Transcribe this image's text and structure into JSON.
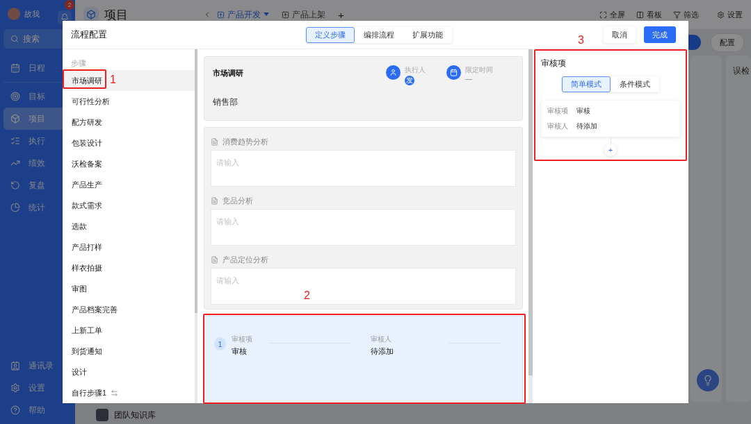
{
  "app": {
    "user": {
      "name": "故我"
    },
    "notifications": {
      "count": "2"
    },
    "search": {
      "placeholder": "搜索"
    },
    "nav": [
      {
        "label": "日程",
        "selected": false
      },
      {
        "label": "目标",
        "selected": false
      },
      {
        "label": "项目",
        "selected": true
      },
      {
        "label": "执行",
        "selected": false
      },
      {
        "label": "绩效",
        "selected": false
      },
      {
        "label": "复盘",
        "selected": false
      },
      {
        "label": "统计",
        "selected": false
      }
    ],
    "nav_bottom": [
      {
        "label": "通讯录"
      },
      {
        "label": "设置"
      },
      {
        "label": "帮助"
      }
    ],
    "page_title": "项目",
    "tabs": [
      {
        "label": "产品开发",
        "selected": true
      },
      {
        "label": "产品上架",
        "selected": false
      }
    ],
    "add_tab": "+",
    "toolbar": [
      {
        "label": "全屏"
      },
      {
        "label": "看板"
      },
      {
        "label": "筛选"
      },
      {
        "label": "设置"
      }
    ],
    "config_button": "配置",
    "column_title": "误检",
    "knowledge_base": "团队知识库"
  },
  "dialog": {
    "title": "流程配置",
    "tabs": [
      {
        "label": "定义步骤",
        "selected": true
      },
      {
        "label": "编排流程",
        "selected": false
      },
      {
        "label": "扩展功能",
        "selected": false
      }
    ],
    "cancel": "取消",
    "done": "完成",
    "steps": {
      "heading": "步骤",
      "items": [
        {
          "label": "市场调研",
          "selected": true,
          "custom": false
        },
        {
          "label": "可行性分析",
          "selected": false,
          "custom": false
        },
        {
          "label": "配方研发",
          "selected": false,
          "custom": false
        },
        {
          "label": "包装设计",
          "selected": false,
          "custom": false
        },
        {
          "label": "沃检备案",
          "selected": false,
          "custom": false
        },
        {
          "label": "产品生产",
          "selected": false,
          "custom": false
        },
        {
          "label": "款式需求",
          "selected": false,
          "custom": false
        },
        {
          "label": "选款",
          "selected": false,
          "custom": false
        },
        {
          "label": "产品打样",
          "selected": false,
          "custom": false
        },
        {
          "label": "样衣拍摄",
          "selected": false,
          "custom": false
        },
        {
          "label": "审图",
          "selected": false,
          "custom": false
        },
        {
          "label": "产品档案完善",
          "selected": false,
          "custom": false
        },
        {
          "label": "上新工单",
          "selected": false,
          "custom": false
        },
        {
          "label": "到货通知",
          "selected": false,
          "custom": false
        },
        {
          "label": "设计",
          "selected": false,
          "custom": false
        },
        {
          "label": "自行步骤1",
          "selected": false,
          "custom": true
        }
      ]
    },
    "step_card": {
      "title": "市场调研",
      "assignee_label": "执行人",
      "assignee": "发",
      "deadline_label": "限定时间",
      "deadline": "—",
      "department": "销售部"
    },
    "fields": [
      {
        "label": "消费趋势分析",
        "placeholder": "请输入"
      },
      {
        "label": "竞品分析",
        "placeholder": "请输入"
      },
      {
        "label": "产品定位分析",
        "placeholder": "请输入"
      }
    ],
    "review_step": {
      "number": "1",
      "item_label": "审核项",
      "item_value": "审核",
      "reviewer_label": "审核人",
      "reviewer_value": "待添加"
    },
    "review_panel": {
      "title": "审核项",
      "modes": [
        {
          "label": "简单模式",
          "selected": true
        },
        {
          "label": "条件模式",
          "selected": false
        }
      ],
      "rows": [
        {
          "label": "审核项",
          "value": "审核"
        },
        {
          "label": "审核人",
          "value": "待添加"
        }
      ],
      "add": "+"
    }
  },
  "annotations": [
    {
      "label": "1"
    },
    {
      "label": "2"
    },
    {
      "label": "3"
    }
  ]
}
